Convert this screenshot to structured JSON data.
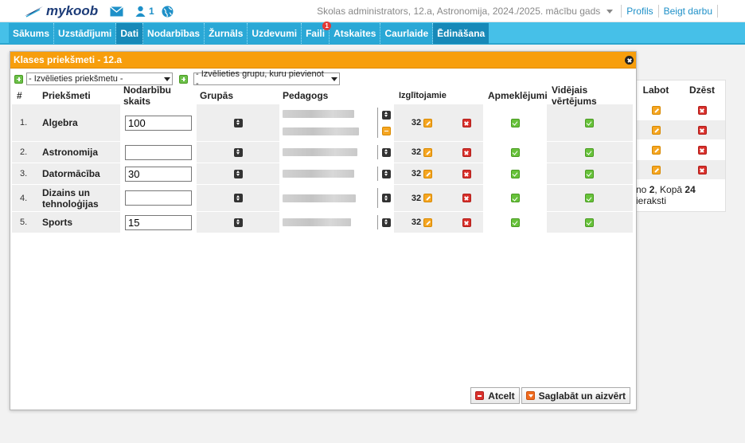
{
  "topbar": {
    "logo_text": "mykoob",
    "people_count": "1",
    "context": "Skolas administrators, 12.a, Astronomija, 2024./2025. mācību gads",
    "profile_link": "Profils",
    "logout_link": "Beigt darbu"
  },
  "nav": [
    {
      "label": "Sākums"
    },
    {
      "label": "Uzstādījumi"
    },
    {
      "label": "Dati"
    },
    {
      "label": "Nodarbības"
    },
    {
      "label": "Žurnāls"
    },
    {
      "label": "Uzdevumi"
    },
    {
      "label": "Faili",
      "badge": "1"
    },
    {
      "label": "Atskaites"
    },
    {
      "label": "Caurlaide"
    },
    {
      "label": "Ēdināšana"
    }
  ],
  "bg_table": {
    "col_edit": "Labot",
    "col_delete": "Dzēst",
    "footer_prefix": "no ",
    "footer_from": "2",
    "footer_mid": ", Kopā ",
    "footer_total": "24",
    "footer_suffix": " ieraksti"
  },
  "modal": {
    "title": "Klases priekšmeti - 12.a",
    "subject_select": "- Izvēlieties priekšmetu -",
    "group_select": "- Izvēlieties grupu, kuru pievienot -",
    "headers": {
      "num": "#",
      "subject": "Priekšmeti",
      "count": "Nodarbību skaits",
      "groups": "Grupās",
      "teacher": "Pedagogs",
      "students": "Izglītojamie",
      "attendance": "Apmeklējumi",
      "average": "Vidējais vērtējums"
    },
    "rows": [
      {
        "num": "1.",
        "name": "Algebra",
        "count": "100",
        "students": "32"
      },
      {
        "num": "2.",
        "name": "Astronomija",
        "count": "",
        "students": "32"
      },
      {
        "num": "3.",
        "name": "Datormācība",
        "count": "30",
        "students": "32"
      },
      {
        "num": "4.",
        "name": "Dizains un tehnoloģijas",
        "count": "",
        "students": "32"
      },
      {
        "num": "5.",
        "name": "Sports",
        "count": "15",
        "students": "32"
      }
    ],
    "cancel_label": "Atcelt",
    "save_label": "Saglabāt un aizvērt"
  },
  "colors": {
    "nav_bg": "#46c0e8",
    "modal_header": "#f79e0c",
    "link": "#1e90c8"
  }
}
